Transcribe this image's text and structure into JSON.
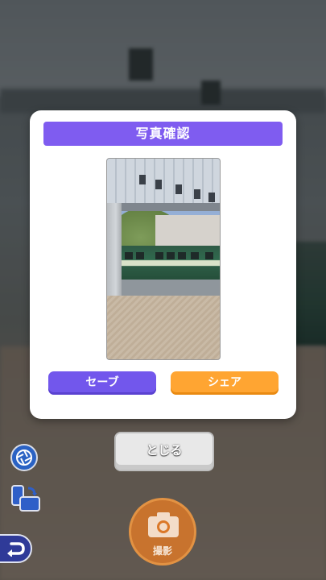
{
  "dialog": {
    "title": "写真確認",
    "save_label": "セーブ",
    "share_label": "シェア"
  },
  "close_label": "とじる",
  "shutter_label": "撮影",
  "icons": {
    "aperture": "camera-aperture-icon",
    "flip": "switch-camera-icon",
    "back": "back-arrow-icon",
    "shutter": "camera-icon"
  },
  "colors": {
    "title_bar": "#7f5cf0",
    "save_button": "#7257ec",
    "share_button": "#ffa532",
    "shutter": "#db7828"
  }
}
